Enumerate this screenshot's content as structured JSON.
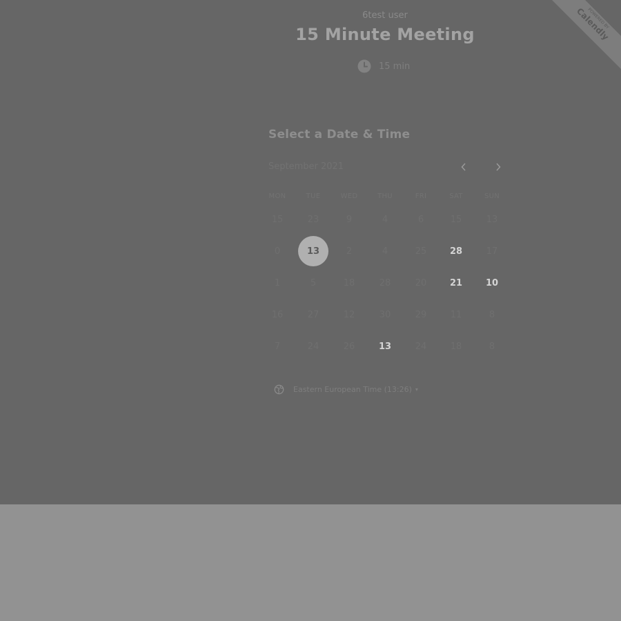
{
  "branding": {
    "ribbon_line1": "POWERED BY",
    "ribbon_brand": "Calendly"
  },
  "event": {
    "host": "6test user",
    "title": "15 Minute Meeting",
    "duration": "15 min",
    "duration_icon": "clock-icon"
  },
  "scheduler": {
    "heading": "Select a Date & Time",
    "month_label": "September 2021",
    "prev_icon": "chevron-left-icon",
    "next_icon": "chevron-right-icon",
    "weekdays": [
      "MON",
      "TUE",
      "WED",
      "THU",
      "FRI",
      "SAT",
      "SUN"
    ],
    "weeks": [
      [
        {
          "label": "15",
          "available": false
        },
        {
          "label": "23",
          "available": false
        },
        {
          "label": "9",
          "available": false
        },
        {
          "label": "4",
          "available": false
        },
        {
          "label": "6",
          "available": false
        },
        {
          "label": "15",
          "available": false
        },
        {
          "label": "13",
          "available": false
        }
      ],
      [
        {
          "label": "0",
          "available": false
        },
        {
          "label": "13",
          "available": true,
          "selected": true
        },
        {
          "label": "2",
          "available": false
        },
        {
          "label": "4",
          "available": false
        },
        {
          "label": "25",
          "available": false
        },
        {
          "label": "28",
          "available": true
        },
        {
          "label": "17",
          "available": false
        }
      ],
      [
        {
          "label": "1",
          "available": false
        },
        {
          "label": "5",
          "available": false
        },
        {
          "label": "18",
          "available": false
        },
        {
          "label": "28",
          "available": false
        },
        {
          "label": "20",
          "available": false
        },
        {
          "label": "21",
          "available": true
        },
        {
          "label": "10",
          "available": true
        }
      ],
      [
        {
          "label": "16",
          "available": false
        },
        {
          "label": "27",
          "available": false
        },
        {
          "label": "12",
          "available": false
        },
        {
          "label": "30",
          "available": false
        },
        {
          "label": "29",
          "available": false
        },
        {
          "label": "11",
          "available": false
        },
        {
          "label": "8",
          "available": false
        }
      ],
      [
        {
          "label": "7",
          "available": false
        },
        {
          "label": "24",
          "available": false
        },
        {
          "label": "26",
          "available": false
        },
        {
          "label": "13",
          "available": true
        },
        {
          "label": "24",
          "available": false
        },
        {
          "label": "18",
          "available": false
        },
        {
          "label": "8",
          "available": false
        }
      ]
    ],
    "timezone_icon": "globe-icon",
    "timezone_label": "Eastern European Time (13:26)",
    "timezone_caret": "▾"
  },
  "colors": {
    "overlay": "#666666",
    "page_background": "#929292",
    "selected_day": "#b0b0b0"
  }
}
